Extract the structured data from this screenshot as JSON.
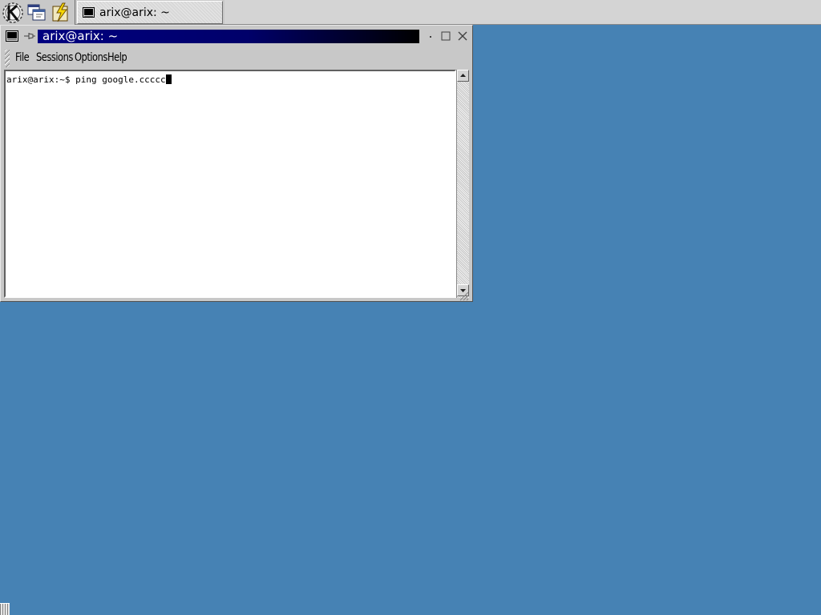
{
  "taskbar": {
    "launchers": [
      {
        "icon": "kde-k-menu-icon"
      },
      {
        "icon": "window-list-icon"
      },
      {
        "icon": "quick-launch-lightning-icon"
      }
    ],
    "tasks": [
      {
        "label": "arix@arix: ~",
        "icon": "terminal-icon"
      }
    ]
  },
  "window": {
    "title": "arix@arix: ~",
    "menu": [
      "File",
      "Sessions",
      "Options",
      "Help"
    ],
    "terminal": {
      "prompt": "arix@arix:~$ ",
      "command": "ping google.ccccc"
    },
    "colors": {
      "title_active_start": "#000080",
      "title_active_end": "#000000",
      "desktop": "#4682b4"
    }
  }
}
